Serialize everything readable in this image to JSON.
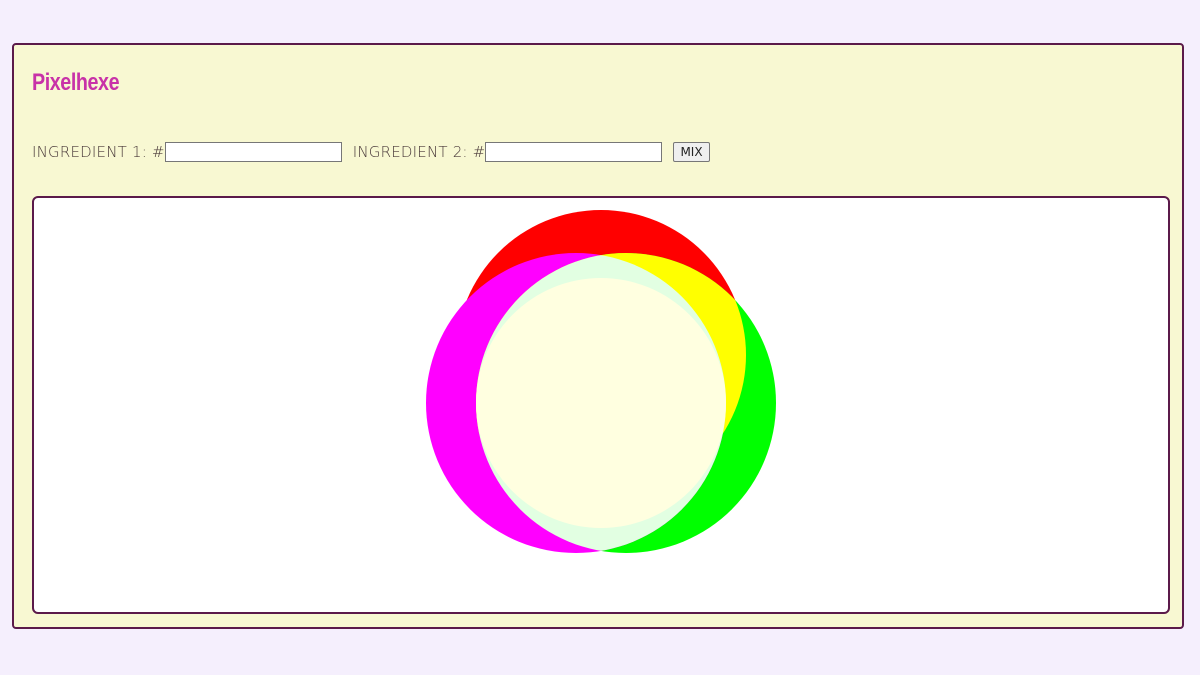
{
  "app": {
    "title": "Pixelhexe"
  },
  "controls": {
    "ingredient1_label": "INGREDIENT 1: #",
    "ingredient1_value": "",
    "ingredient2_label": "INGREDIENT 2: #",
    "ingredient2_value": "",
    "mix_label": "MIX"
  },
  "colors": {
    "page_background": "#f5effd",
    "panel_background": "#f8f8d2",
    "border": "#5b1a4a",
    "title": "#c832a8",
    "circle_red": "#ff0000",
    "circle_green": "#00ff00",
    "circle_magenta": "#ff00ff",
    "overlap_yellow": "#ffff00",
    "overlap_mint": "#e2ffe2",
    "center_fill": "#ffffe0"
  }
}
